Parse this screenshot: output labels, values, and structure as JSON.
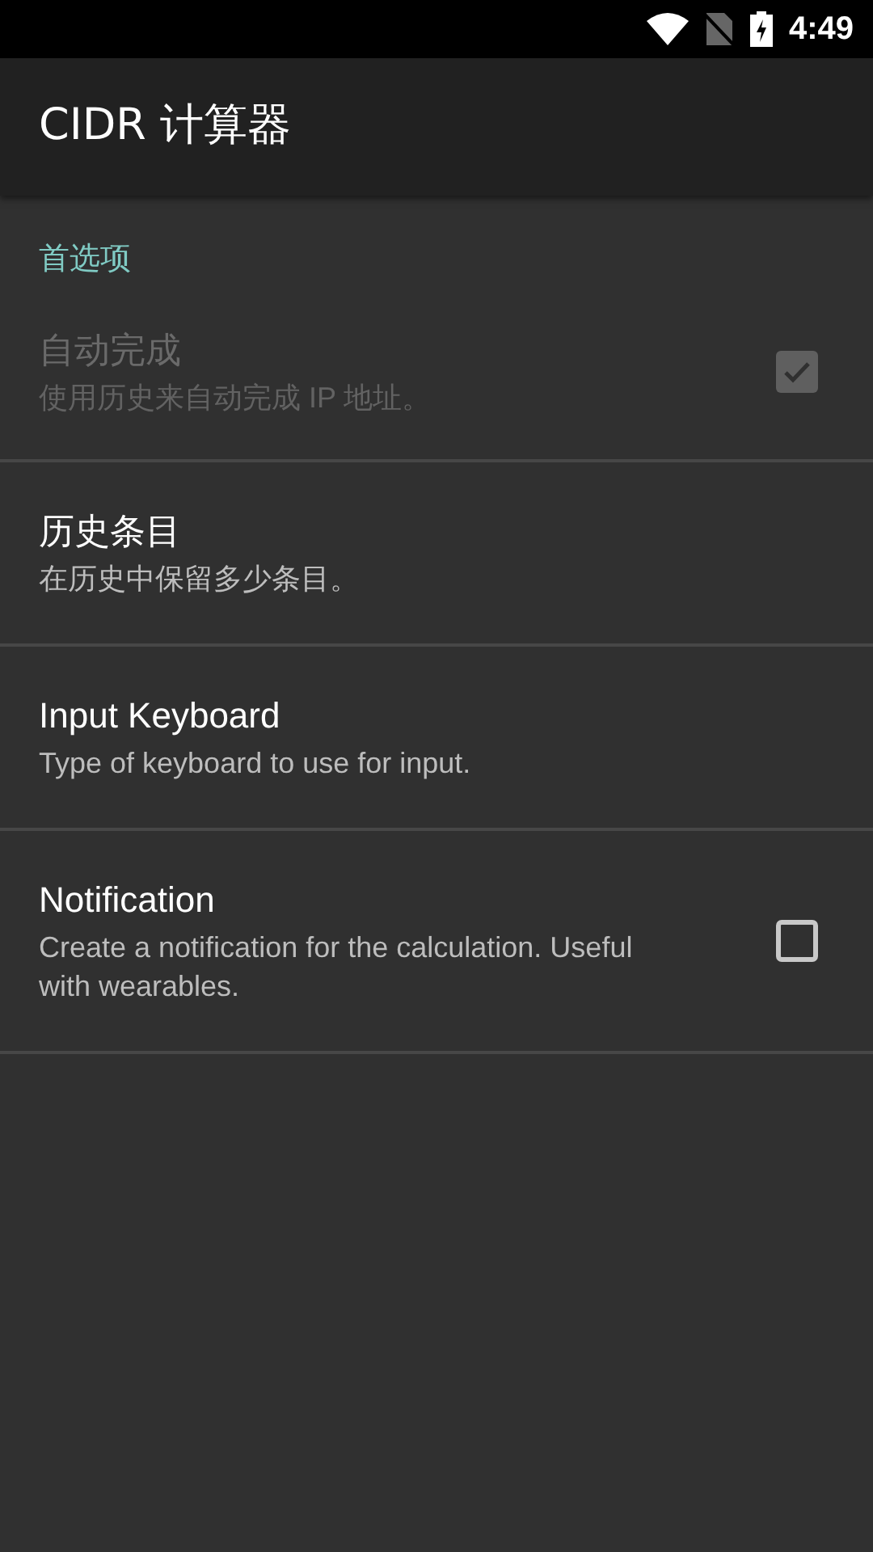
{
  "status_bar": {
    "time": "4:49"
  },
  "app_bar": {
    "title": "CIDR 计算器"
  },
  "section": {
    "title": "首选项"
  },
  "items": [
    {
      "kind": "checkbox",
      "title": "自动完成",
      "summary": "使用历史来自动完成 IP 地址。",
      "disabled": true,
      "checked": true
    },
    {
      "kind": "plain",
      "title": "历史条目",
      "summary": "在历史中保留多少条目。",
      "disabled": false
    },
    {
      "kind": "plain",
      "title": "Input Keyboard",
      "summary": "Type of keyboard to use for input.",
      "disabled": false
    },
    {
      "kind": "checkbox",
      "title": "Notification",
      "summary": "Create a notification for the calculation. Useful with wearables.",
      "disabled": false,
      "checked": false
    }
  ]
}
